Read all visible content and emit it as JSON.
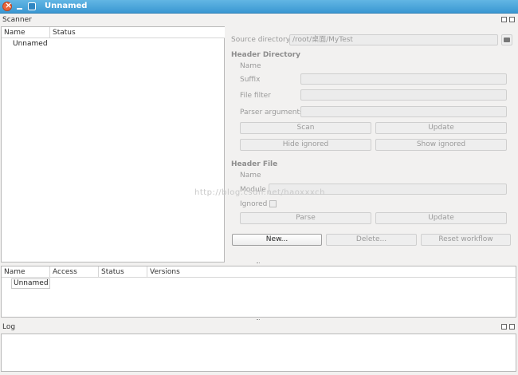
{
  "window": {
    "title": "Unnamed"
  },
  "scanner": {
    "title": "Scanner",
    "headers": [
      "Name",
      "Status"
    ],
    "rows": [
      {
        "name": "Unnamed",
        "status": ""
      }
    ]
  },
  "form": {
    "source_directory_label": "Source directory",
    "source_directory_value": "/root/桌面/MyTest",
    "header_directory_title": "Header Directory",
    "name_label": "Name",
    "suffix_label": "Suffix",
    "file_filter_label": "File filter",
    "parser_arguments_label": "Parser arguments",
    "scan_button": "Scan",
    "update_button": "Update",
    "hide_ignored_button": "Hide ignored",
    "show_ignored_button": "Show ignored",
    "header_file_title": "Header File",
    "file_name_label": "Name",
    "module_label": "Module",
    "ignored_label": "Ignored",
    "parse_button": "Parse",
    "update_button_2": "Update",
    "new_button": "New...",
    "delete_button": "Delete...",
    "reset_workflow_button": "Reset workflow"
  },
  "modules": {
    "headers": [
      "Name",
      "Access",
      "Status",
      "Versions"
    ],
    "rows": [
      {
        "name": "Unnamed"
      }
    ]
  },
  "log": {
    "title": "Log"
  },
  "watermark": "http://blog.csdn.net/haoxxxch"
}
